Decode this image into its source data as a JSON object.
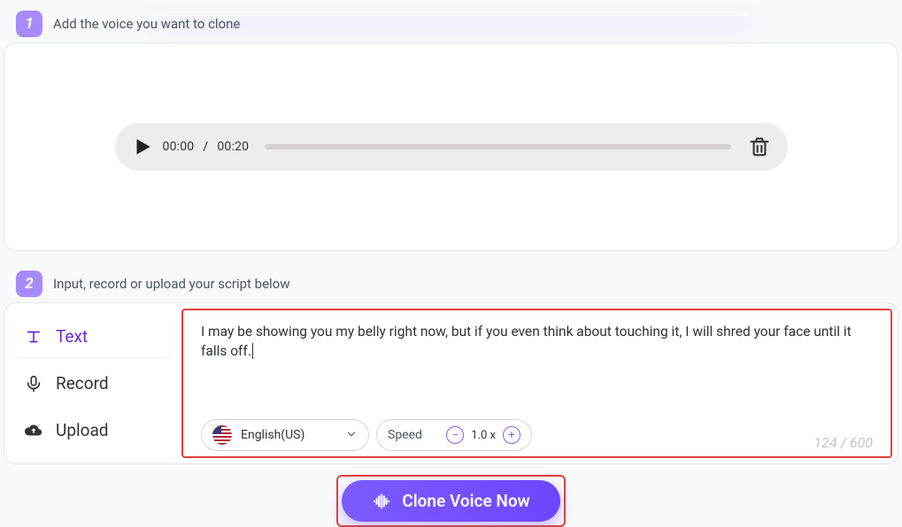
{
  "step1": {
    "badge": "1",
    "title": "Add the voice you want to clone",
    "player": {
      "current": "00:00",
      "sep": "/",
      "total": "00:20"
    }
  },
  "step2": {
    "badge": "2",
    "title": "Input, record or upload your script below",
    "tabs": {
      "text": "Text",
      "record": "Record",
      "upload": "Upload"
    },
    "script": "I may be showing you my belly right now, but if you even think about touching it, I will shred your face until it falls off.",
    "lang": {
      "label": "English(US)"
    },
    "speed": {
      "label": "Speed",
      "value": "1.0 x"
    },
    "count": "124 / 600"
  },
  "cta": {
    "label": "Clone Voice Now"
  }
}
